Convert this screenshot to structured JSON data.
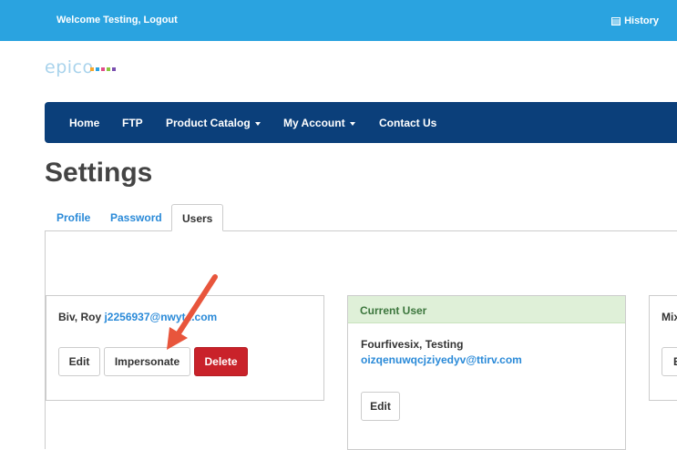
{
  "topbar": {
    "welcome": "Welcome Testing, Logout",
    "history_label": "History"
  },
  "logo": {
    "text": "epico",
    "dot_colors": [
      "#f7a72b",
      "#2aa3e0",
      "#e04c8a",
      "#8cc63f",
      "#7a4fb0"
    ]
  },
  "nav": {
    "items": [
      {
        "label": "Home"
      },
      {
        "label": "FTP"
      },
      {
        "label": "Product Catalog"
      },
      {
        "label": "My Account"
      },
      {
        "label": "Contact Us"
      }
    ]
  },
  "page": {
    "title": "Settings"
  },
  "tabs": [
    {
      "label": "Profile",
      "active": false
    },
    {
      "label": "Password",
      "active": false
    },
    {
      "label": "Users",
      "active": true
    }
  ],
  "users": [
    {
      "name": "Biv, Roy",
      "email": "j2256937@nwyt...com",
      "buttons": {
        "edit": "Edit",
        "impersonate": "Impersonate",
        "delete": "Delete"
      }
    },
    {
      "header": "Current User",
      "name": "Fourfivesix, Testing",
      "email": "oizqenuwqcjziyedyv@ttirv.com",
      "buttons": {
        "edit": "Edit"
      }
    },
    {
      "name": "Mix",
      "buttons": {
        "edit": "E"
      }
    }
  ],
  "colors": {
    "topbar": "#2aa3e0",
    "navbar": "#0b3f7a",
    "link": "#2a8ad8",
    "danger": "#c9222a",
    "current_user_header": "#dff0d8",
    "annotation_arrow": "#e8553c"
  }
}
